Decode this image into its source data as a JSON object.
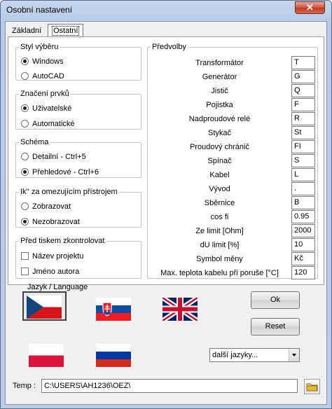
{
  "window": {
    "title": "Osobní nastavení",
    "close_glyph": "✕"
  },
  "tabs": [
    {
      "label": "Základní"
    },
    {
      "label": "Ostatní"
    }
  ],
  "groups": {
    "styl": {
      "title": "Styl výběru",
      "options": [
        {
          "label": "Windows",
          "selected": true
        },
        {
          "label": "AutoCAD",
          "selected": false
        }
      ]
    },
    "znaceni": {
      "title": "Značení prvků",
      "options": [
        {
          "label": "Uživatelské",
          "selected": true
        },
        {
          "label": "Automatické",
          "selected": false
        }
      ]
    },
    "schema": {
      "title": "Schéma",
      "options": [
        {
          "label": "Detailní - Ctrl+5",
          "selected": false
        },
        {
          "label": "Přehledové - Ctrl+6",
          "selected": true
        }
      ]
    },
    "ik": {
      "title": "Ik'' za omezujícím přístrojem",
      "options": [
        {
          "label": "Zobrazovat",
          "selected": false
        },
        {
          "label": "Nezobrazovat",
          "selected": true
        }
      ]
    },
    "tisk": {
      "title": "Před tiskem zkontrolovat",
      "checks": [
        {
          "label": "Název projektu",
          "checked": false
        },
        {
          "label": "Jméno autora",
          "checked": false
        }
      ]
    }
  },
  "predvolby": {
    "title": "Předvolby",
    "rows": [
      {
        "label": "Transformátor",
        "value": "T"
      },
      {
        "label": "Generátor",
        "value": "G"
      },
      {
        "label": "Jistič",
        "value": "Q"
      },
      {
        "label": "Pojistka",
        "value": "F"
      },
      {
        "label": "Nadproudové relé",
        "value": "R"
      },
      {
        "label": "Stykač",
        "value": "St"
      },
      {
        "label": "Proudový chránič",
        "value": "FI"
      },
      {
        "label": "Spínač",
        "value": "S"
      },
      {
        "label": "Kabel",
        "value": "L"
      },
      {
        "label": "Vývod",
        "value": "."
      },
      {
        "label": "Sběrnice",
        "value": "B"
      },
      {
        "label": "cos fi",
        "value": "0.95"
      },
      {
        "label": "Ze limit  [Ohm]",
        "value": "2000"
      },
      {
        "label": "dU limit [%]",
        "value": "10"
      },
      {
        "label": "Symbol měny",
        "value": "Kč"
      },
      {
        "label": "Max. teplota kabelu při poruše [°C]",
        "value": "120"
      }
    ]
  },
  "language": {
    "title": "Jazyk / Language",
    "flags": [
      "czech-flag",
      "slovak-flag",
      "uk-flag",
      "polish-flag",
      "russian-flag"
    ],
    "selected_flag": "czech-flag",
    "more_select": {
      "value": "další jazyky..."
    }
  },
  "buttons": {
    "ok": "Ok",
    "reset": "Reset"
  },
  "temp": {
    "label": "Temp :",
    "value": "C:\\USERS\\AH1236\\OEZ\\"
  },
  "icons": {
    "folder": "folder-icon",
    "close": "close-icon",
    "dropdown": "chevron-down-icon"
  }
}
